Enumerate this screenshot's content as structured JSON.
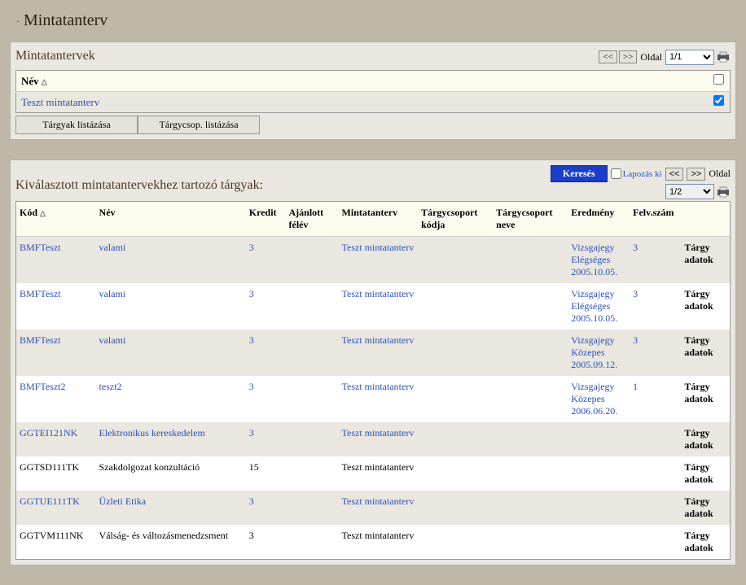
{
  "page": {
    "title": "Mintatanterv"
  },
  "panel1": {
    "title": "Mintatantervek",
    "pager": {
      "prev": "<<",
      "next": ">>",
      "label": "Oldal",
      "select": "1/1"
    },
    "header_col": "Név",
    "row_label": "Teszt mintatanterv",
    "btn_targyak": "Tárgyak listázása",
    "btn_targycsop": "Tárgycsop. listázása"
  },
  "panel2": {
    "title": "Kiválasztott mintatantervekhez tartozó tárgyak:",
    "search": "Keresés",
    "lapozas": "Lapozás ki",
    "pager": {
      "prev": "<<",
      "next": ">>",
      "label": "Oldal",
      "select": "1/2"
    },
    "cols": {
      "kod": "Kód",
      "nev": "Név",
      "kredit": "Kredit",
      "ajanlott": "Ajánlott félév",
      "mintatanterv": "Mintatanterv",
      "csoport_kod": "Tárgycsoport kódja",
      "csoport_nev": "Tárgycsoport neve",
      "eredmeny": "Eredmény",
      "felv": "Felv.szám",
      "action": ""
    },
    "action_label": "Tárgy adatok",
    "rows": [
      {
        "kod": "BMFTeszt",
        "nev": "valami",
        "kredit": "3",
        "ajanlott": "",
        "mt": "Teszt mintatanterv",
        "cskod": "",
        "csnev": "",
        "ered": "Vizsgajegy Elégséges 2005.10.05.",
        "felv": "3",
        "link": true,
        "eredlink": true
      },
      {
        "kod": "BMFTeszt",
        "nev": "valami",
        "kredit": "3",
        "ajanlott": "",
        "mt": "Teszt mintatanterv",
        "cskod": "",
        "csnev": "",
        "ered": "Vizsgajegy Elégséges 2005.10.05.",
        "felv": "3",
        "link": true,
        "eredlink": true
      },
      {
        "kod": "BMFTeszt",
        "nev": "valami",
        "kredit": "3",
        "ajanlott": "",
        "mt": "Teszt mintatanterv",
        "cskod": "",
        "csnev": "",
        "ered": "Vizsgajegy Közepes 2005.09.12.",
        "felv": "3",
        "link": true,
        "eredlink": true
      },
      {
        "kod": "BMFTeszt2",
        "nev": "teszt2",
        "kredit": "3",
        "ajanlott": "",
        "mt": "Teszt mintatanterv",
        "cskod": "",
        "csnev": "",
        "ered": "Vizsgajegy Közepes 2006.06.20.",
        "felv": "1",
        "link": true,
        "eredlink": true
      },
      {
        "kod": "GGTEI121NK",
        "nev": "Elektronikus kereskedelem",
        "kredit": "3",
        "ajanlott": "",
        "mt": "Teszt mintatanterv",
        "cskod": "",
        "csnev": "",
        "ered": "",
        "felv": "",
        "link": true,
        "eredlink": false
      },
      {
        "kod": "GGTSD111TK",
        "nev": "Szakdolgozat konzultáció",
        "kredit": "15",
        "ajanlott": "",
        "mt": "Teszt mintatanterv",
        "cskod": "",
        "csnev": "",
        "ered": "",
        "felv": "",
        "link": false,
        "eredlink": false
      },
      {
        "kod": "GGTUE111TK",
        "nev": "Üzleti Etika",
        "kredit": "3",
        "ajanlott": "",
        "mt": "Teszt mintatanterv",
        "cskod": "",
        "csnev": "",
        "ered": "",
        "felv": "",
        "link": true,
        "eredlink": false
      },
      {
        "kod": "GGTVM111NK",
        "nev": "Válság- és változásmenedzsment",
        "kredit": "3",
        "ajanlott": "",
        "mt": "Teszt mintatanterv",
        "cskod": "",
        "csnev": "",
        "ered": "",
        "felv": "",
        "link": false,
        "eredlink": false
      }
    ]
  }
}
